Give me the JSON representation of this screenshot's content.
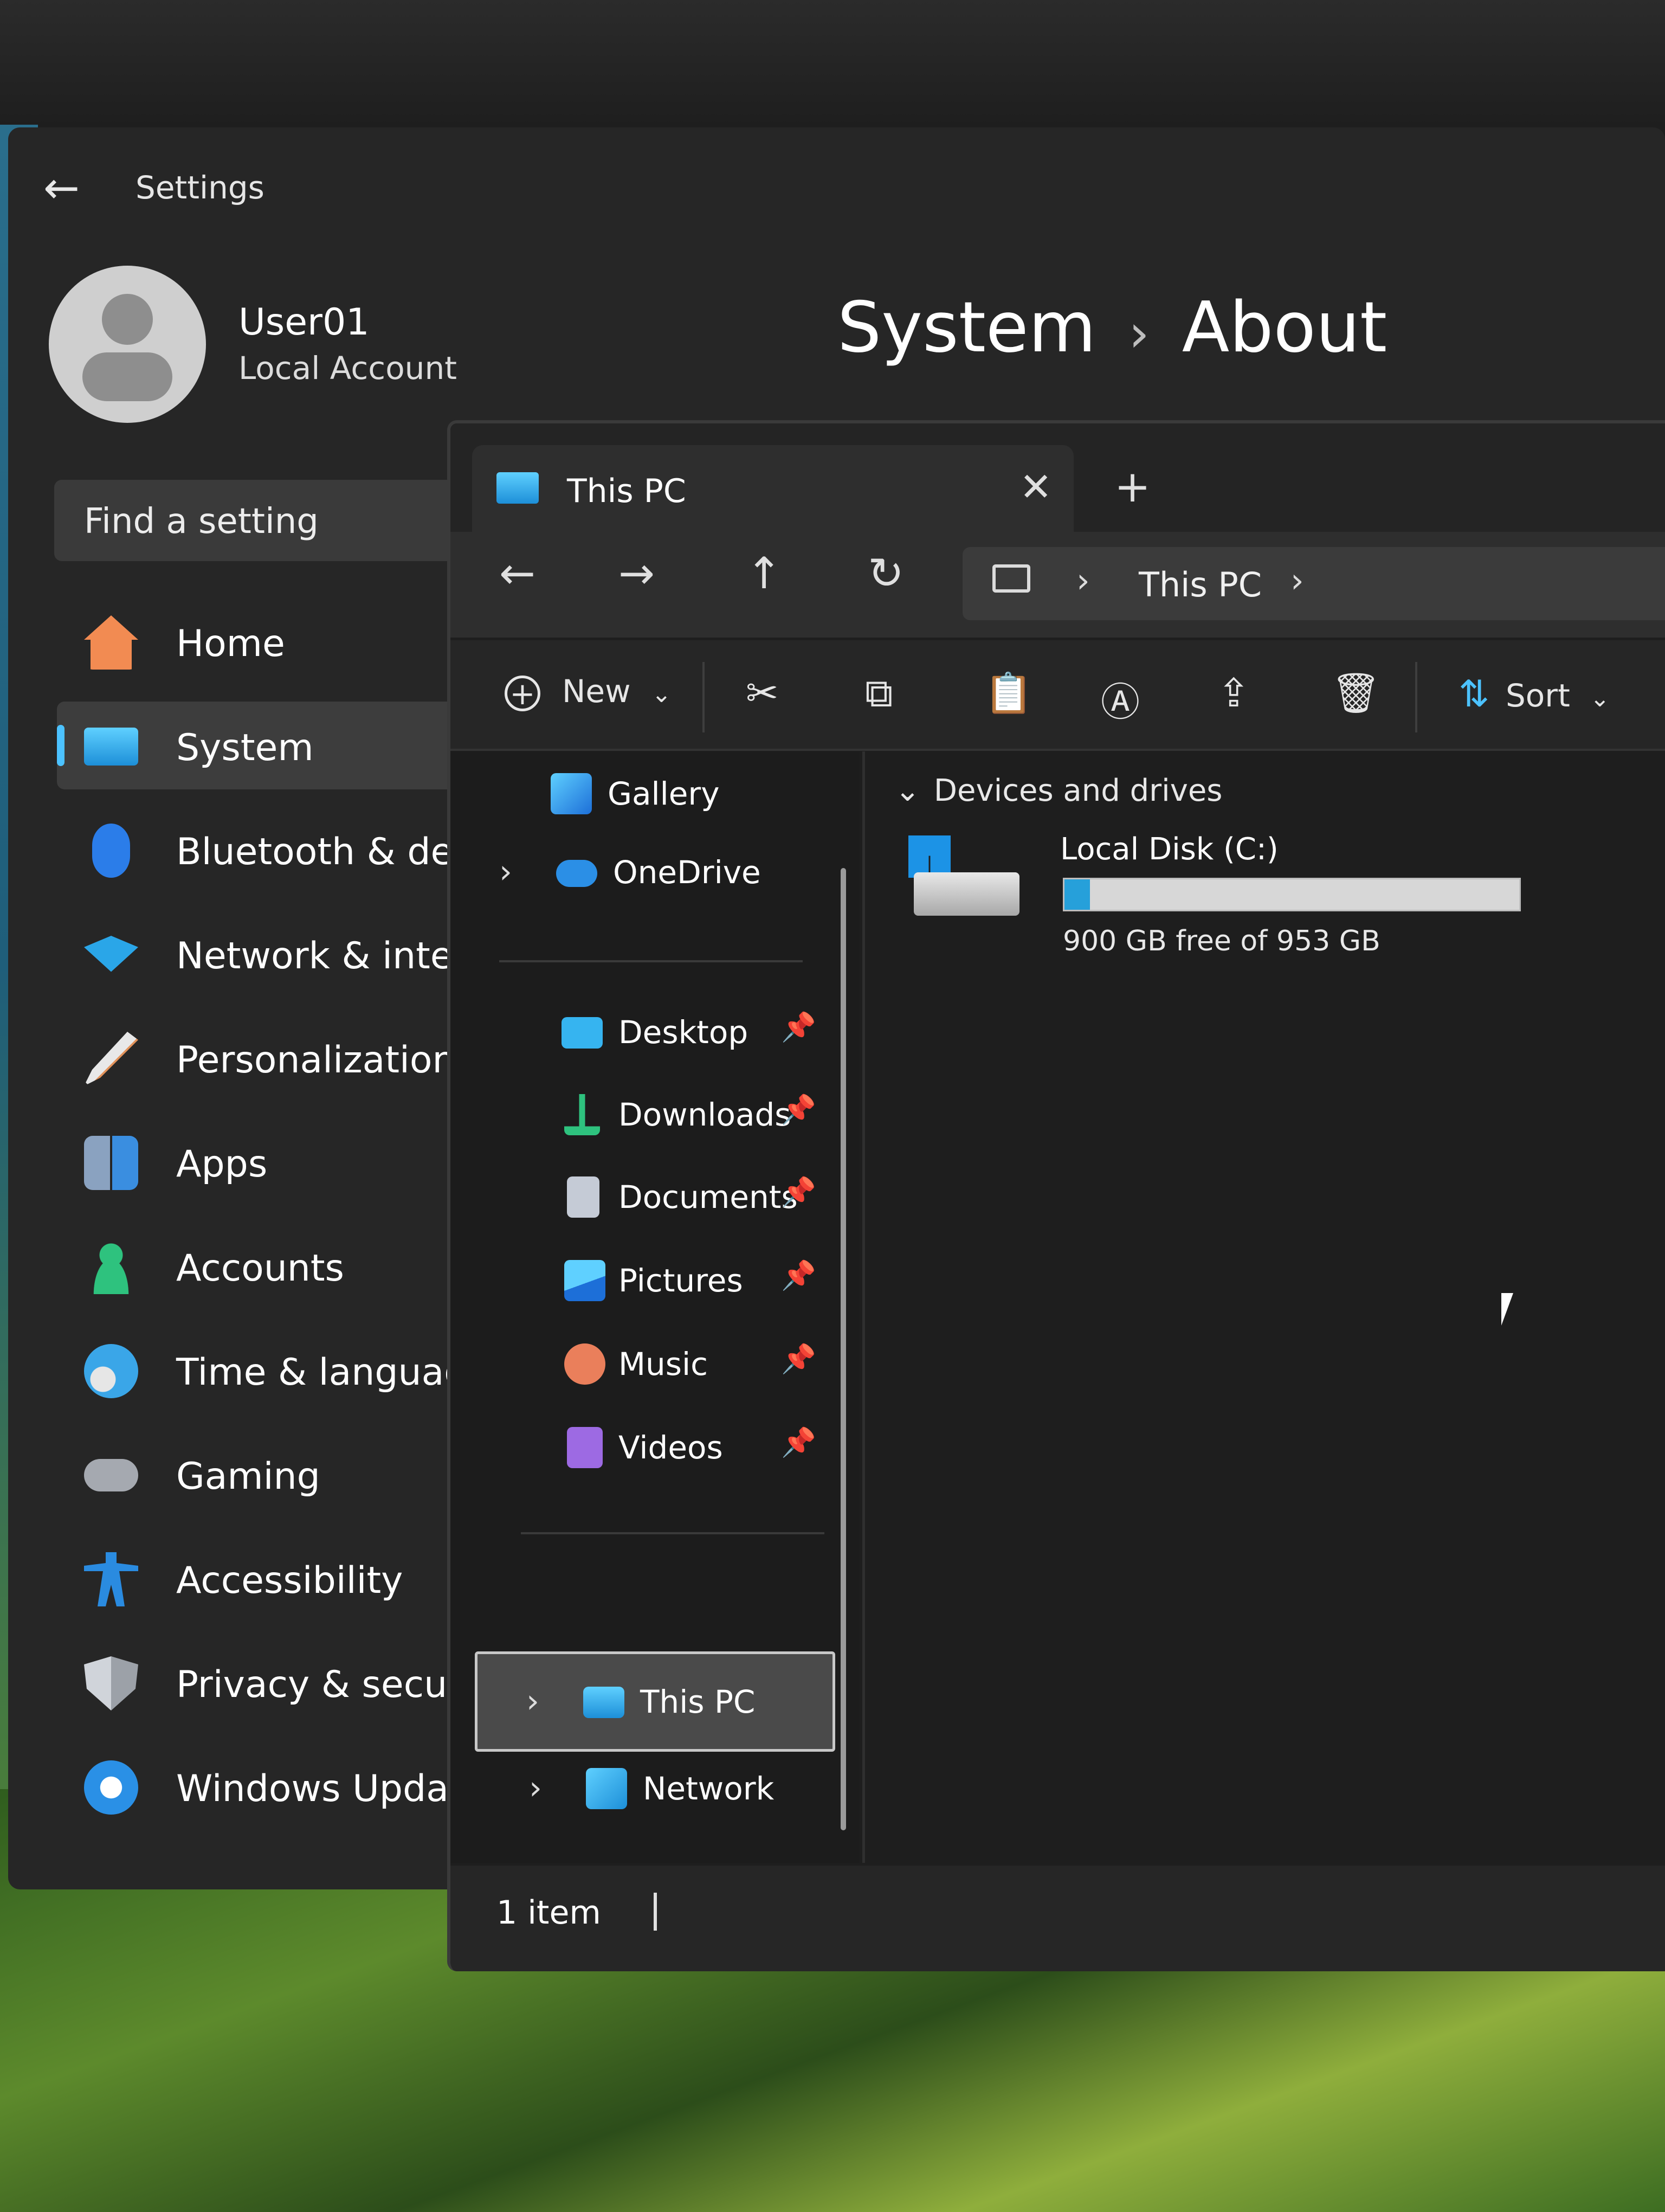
{
  "settings": {
    "title": "Settings",
    "user": {
      "name": "User01",
      "account_type": "Local Account"
    },
    "breadcrumb": {
      "section": "System",
      "separator": "›",
      "page": "About"
    },
    "search": {
      "placeholder": "Find a setting"
    },
    "nav": [
      {
        "label": "Home",
        "icon": "home-icon",
        "color": "#f28b52",
        "selected": false
      },
      {
        "label": "System",
        "icon": "monitor-icon",
        "color": "#29a3e8",
        "selected": true
      },
      {
        "label": "Bluetooth & devi",
        "icon": "bluetooth-icon",
        "color": "#2b7de9",
        "selected": false
      },
      {
        "label": "Network & intern",
        "icon": "wifi-icon",
        "color": "#2aa6e8",
        "selected": false
      },
      {
        "label": "Personalization",
        "icon": "brush-icon",
        "color": "#e2925a",
        "selected": false
      },
      {
        "label": "Apps",
        "icon": "apps-icon",
        "color": "#8aa2c0",
        "selected": false
      },
      {
        "label": "Accounts",
        "icon": "person-icon",
        "color": "#2ec27e",
        "selected": false
      },
      {
        "label": "Time & language",
        "icon": "globe-clock-icon",
        "color": "#3aa6e8",
        "selected": false
      },
      {
        "label": "Gaming",
        "icon": "gamepad-icon",
        "color": "#a5a9b0",
        "selected": false
      },
      {
        "label": "Accessibility",
        "icon": "accessibility-icon",
        "color": "#2a8be0",
        "selected": false
      },
      {
        "label": "Privacy & security",
        "icon": "shield-icon",
        "color": "#b8bcc2",
        "selected": false
      },
      {
        "label": "Windows Update",
        "icon": "update-icon",
        "color": "#2a90e6",
        "selected": false
      }
    ]
  },
  "explorer": {
    "tab": {
      "title": "This PC",
      "close": "✕",
      "new_tab": "+"
    },
    "nav_buttons": {
      "back": "←",
      "forward": "→",
      "up": "↑",
      "refresh": "↻"
    },
    "address": {
      "separator": "›",
      "location": "This PC"
    },
    "toolbar": {
      "new_label": "New",
      "sort_label": "Sort",
      "dropdown": "⌄",
      "icons": [
        "cut-icon",
        "copy-icon",
        "paste-icon",
        "rename-icon",
        "share-icon",
        "delete-icon"
      ]
    },
    "sidebar": {
      "top": [
        {
          "label": "Gallery",
          "icon": "gallery-icon",
          "expandable": false
        },
        {
          "label": "OneDrive",
          "icon": "cloud-icon",
          "expandable": true
        }
      ],
      "pinned": [
        {
          "label": "Desktop",
          "icon": "desktop-icon",
          "color": "#36b4f0"
        },
        {
          "label": "Downloads",
          "icon": "download-icon",
          "color": "#2ec27e"
        },
        {
          "label": "Documents",
          "icon": "document-icon",
          "color": "#c5cbd6"
        },
        {
          "label": "Pictures",
          "icon": "picture-icon",
          "color": "#3a9ee8"
        },
        {
          "label": "Music",
          "icon": "music-icon",
          "color": "#ea7f5b"
        },
        {
          "label": "Videos",
          "icon": "video-icon",
          "color": "#9d6ae3"
        }
      ],
      "bottom": [
        {
          "label": "This PC",
          "icon": "computer-icon",
          "selected": true
        },
        {
          "label": "Network",
          "icon": "network-icon",
          "selected": false
        }
      ],
      "pin_glyph": "📌",
      "chevron": "›"
    },
    "content": {
      "group": "Devices and drives",
      "group_chevron": "⌄",
      "drives": [
        {
          "name": "Local Disk (C:)",
          "free_text": "900 GB free of 953 GB",
          "used_fraction": 0.056
        }
      ]
    },
    "status": {
      "item_count": "1 item"
    }
  }
}
